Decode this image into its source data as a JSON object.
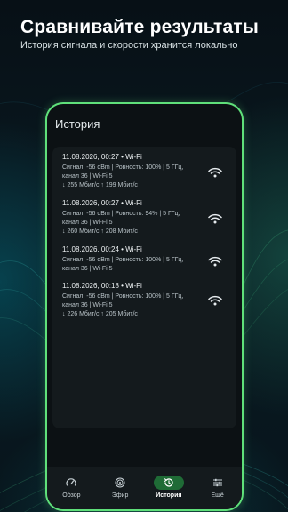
{
  "hero": {
    "title": "Сравнивайте результаты",
    "subtitle": "История сигнала и скорости хранится локально"
  },
  "screen": {
    "title": "История"
  },
  "history": [
    {
      "title": "11.08.2026, 00:27 • Wi-Fi",
      "detail": "Сигнал: -56 dBm | Ровность: 100% | 5 ГГц, канал 36 | Wi-Fi 5",
      "speed": "↓ 255 Мбит/с  ↑ 199 Мбит/с",
      "icon": "wifi-icon"
    },
    {
      "title": "11.08.2026, 00:27 • Wi-Fi",
      "detail": "Сигнал: -56 dBm | Ровность: 94% | 5 ГГц, канал 36 | Wi-Fi 5",
      "speed": "↓ 260 Мбит/с  ↑ 208 Мбит/с",
      "icon": "wifi-icon"
    },
    {
      "title": "11.08.2026, 00:24 • Wi-Fi",
      "detail": "Сигнал: -56 dBm | Ровность: 100% | 5 ГГц, канал 36 | Wi-Fi 5",
      "speed": "",
      "icon": "wifi-icon"
    },
    {
      "title": "11.08.2026, 00:18 • Wi-Fi",
      "detail": "Сигнал: -56 dBm | Ровность: 100% | 5 ГГц, канал 36 | Wi-Fi 5",
      "speed": "↓ 226 Мбит/с  ↑ 205 Мбит/с",
      "icon": "wifi-icon"
    }
  ],
  "nav": [
    {
      "label": "Обзор",
      "icon": "speedometer-icon",
      "active": false
    },
    {
      "label": "Эфир",
      "icon": "radar-icon",
      "active": false
    },
    {
      "label": "История",
      "icon": "history-icon",
      "active": true
    },
    {
      "label": "Ещё",
      "icon": "sliders-icon",
      "active": false
    }
  ],
  "colors": {
    "accent": "#5fe07a",
    "active_nav_bg": "#1f6b36"
  }
}
